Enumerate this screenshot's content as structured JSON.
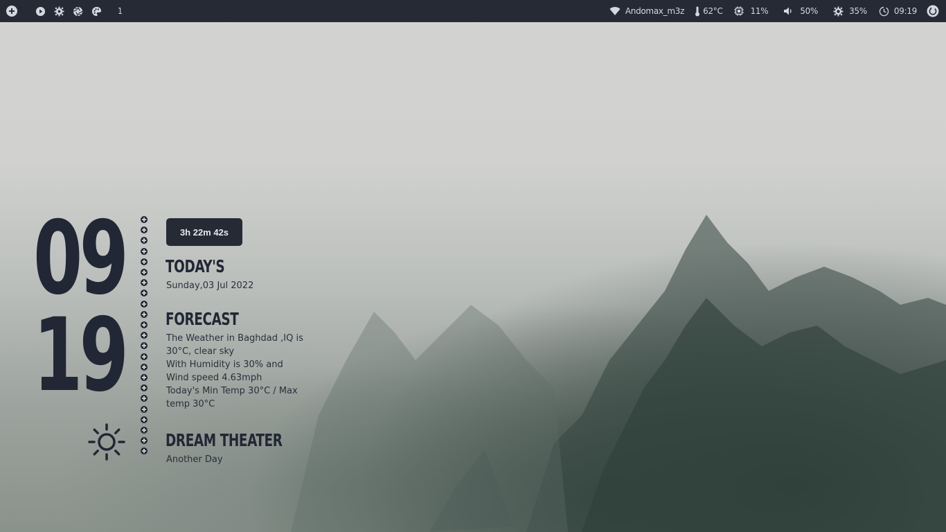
{
  "colors": {
    "bar_bg": "#262a35",
    "bar_text": "#d5d8df",
    "widget_dark": "#222735"
  },
  "topbar": {
    "left_icons": [
      "add-icon",
      "play-icon",
      "gear-icon",
      "aperture-icon",
      "palette-icon"
    ],
    "workspace": "1",
    "wifi": {
      "icon": "wifi-icon",
      "label": "Andomax_m3z"
    },
    "temperature": {
      "icon": "thermometer-icon",
      "label": "62°C"
    },
    "cpu": {
      "icon": "cpu-icon",
      "label": "11%"
    },
    "volume": {
      "icon": "speaker-icon",
      "label": "50%"
    },
    "brightness": {
      "icon": "brightness-icon",
      "label": "35%"
    },
    "clock": {
      "icon": "clock-icon",
      "label": "09:19"
    },
    "power": {
      "icon": "power-icon"
    }
  },
  "widget": {
    "hour": "09",
    "minute": "19",
    "weather_icon": "sun-icon",
    "uptime": "3h 22m 42s",
    "today": {
      "title": "Today's",
      "date": "Sunday,03 Jul 2022"
    },
    "forecast": {
      "title": "Forecast",
      "line1": "The Weather in Baghdad ,IQ  is 30°C, clear sky",
      "line2": "With Humidity is 30% and Wind speed 4.63mph",
      "line3": "Today's Min Temp 30°C / Max temp 30°C"
    },
    "music": {
      "artist": "Dream Theater",
      "track": "Another Day"
    }
  }
}
